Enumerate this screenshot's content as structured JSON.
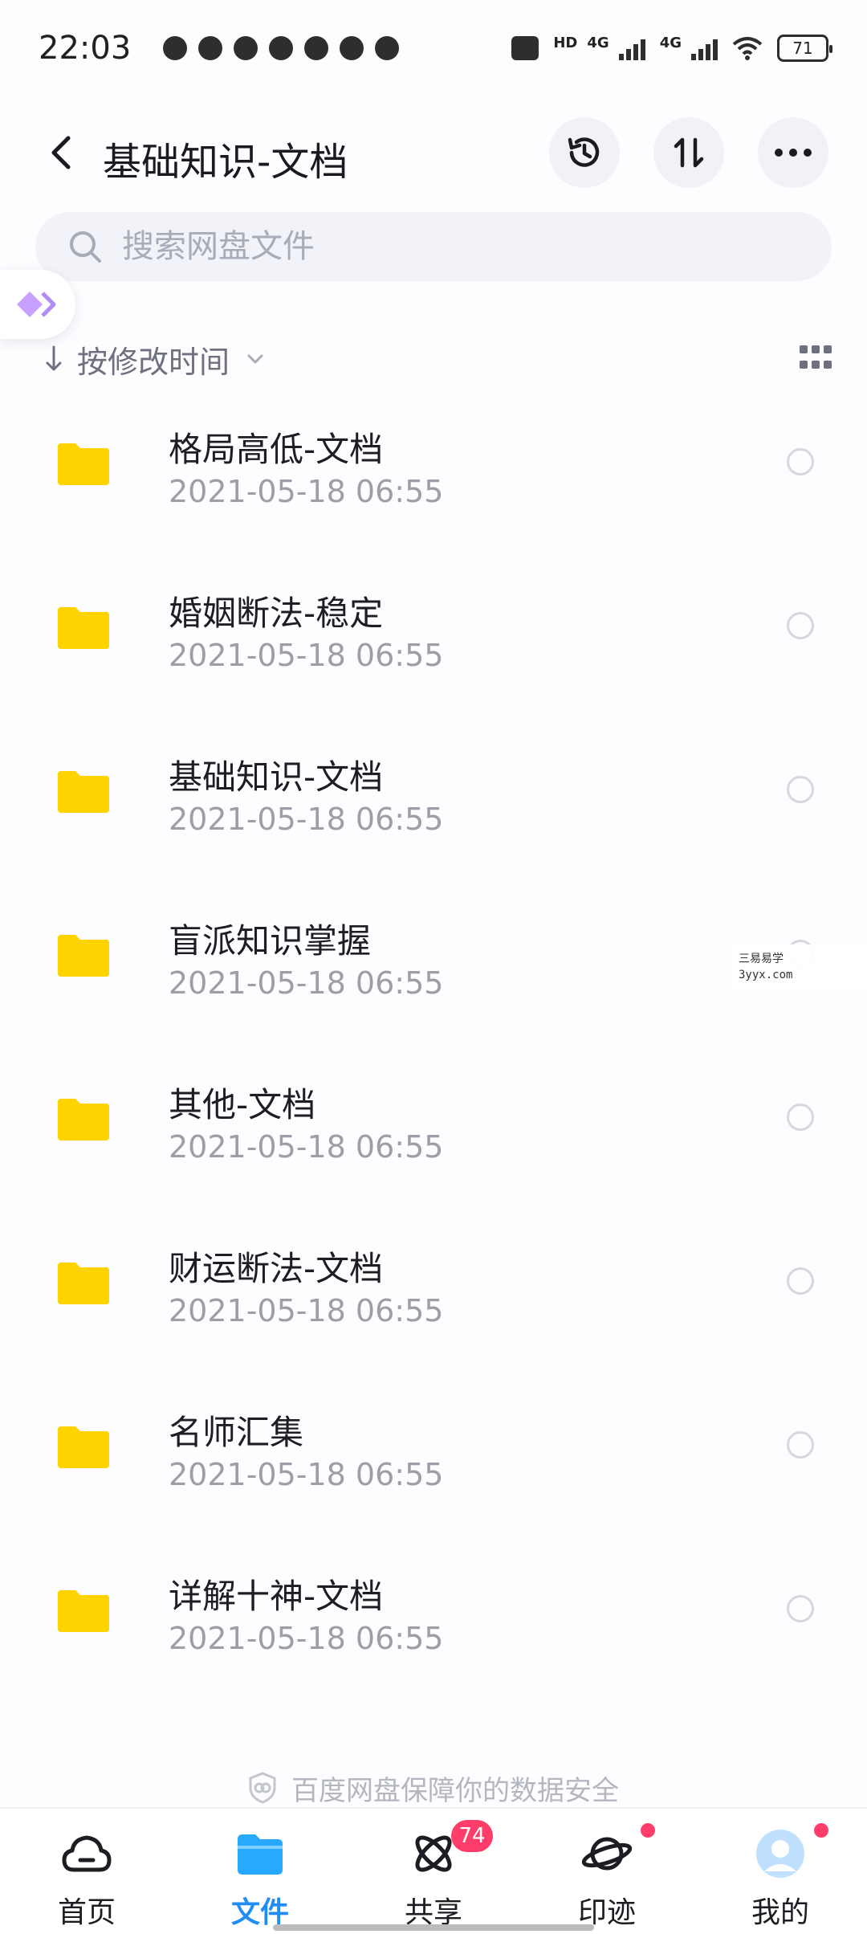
{
  "status_bar": {
    "time": "22:03",
    "hd_label": "HD",
    "network_1": "4G",
    "network_2": "4G",
    "battery": "71"
  },
  "header": {
    "title": "基础知识-文档",
    "history_icon": "history-icon",
    "sort_icon": "sort-icon",
    "more_icon": "more-icon"
  },
  "search": {
    "placeholder": "搜索网盘文件"
  },
  "sort": {
    "label": "按修改时间"
  },
  "files": [
    {
      "name": "格局高低-文档",
      "date": "2021-05-18  06:55"
    },
    {
      "name": "婚姻断法-稳定",
      "date": "2021-05-18  06:55"
    },
    {
      "name": "基础知识-文档",
      "date": "2021-05-18  06:55"
    },
    {
      "name": "盲派知识掌握",
      "date": "2021-05-18  06:55"
    },
    {
      "name": "其他-文档",
      "date": "2021-05-18  06:55"
    },
    {
      "name": "财运断法-文档",
      "date": "2021-05-18  06:55"
    },
    {
      "name": "名师汇集",
      "date": "2021-05-18  06:55"
    },
    {
      "name": "详解十神-文档",
      "date": "2021-05-18  06:55"
    }
  ],
  "watermark": {
    "line1": "三易易学",
    "line2": "3yyx.com"
  },
  "security_note": "百度网盘保障你的数据安全",
  "bottom_nav": [
    {
      "label": "首页",
      "icon": "cloud-home-icon"
    },
    {
      "label": "文件",
      "icon": "folder-icon",
      "active": true
    },
    {
      "label": "共享",
      "icon": "atom-share-icon",
      "badge": "74"
    },
    {
      "label": "印迹",
      "icon": "planet-icon"
    },
    {
      "label": "我的",
      "icon": "avatar-icon"
    }
  ],
  "colors": {
    "accent": "#1f8df5",
    "folder": "#ffd300",
    "badge": "#ff3d6a"
  }
}
